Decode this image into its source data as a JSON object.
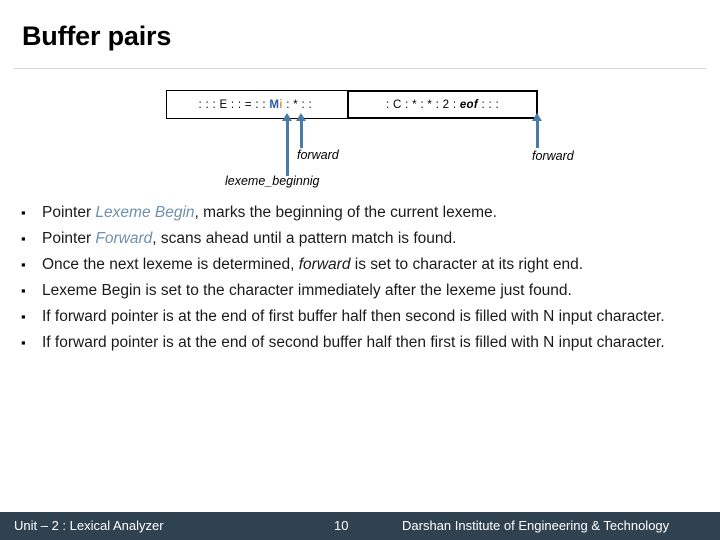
{
  "slide": {
    "title": "Buffer pairs"
  },
  "diagram": {
    "buffer": {
      "left_half": {
        "prefix": ": : : E : : = : : ",
        "char_blue": "M",
        "char_tan": "i",
        "suffix": " : * : : "
      },
      "right_half": {
        "prefix": ": C : * : * : 2 : ",
        "eof": "eof",
        "suffix": " : : :"
      }
    },
    "labels": {
      "forward_left": "forward",
      "forward_right": "forward",
      "lexeme_begin": "lexeme_beginnig"
    },
    "arrow_color": "#4a7ba7"
  },
  "bullets": [
    {
      "marker": "▪",
      "parts": [
        {
          "text": "Pointer ",
          "style": "normal"
        },
        {
          "text": "Lexeme Begin",
          "style": "highlight"
        },
        {
          "text": ", marks the beginning of the current lexeme.",
          "style": "normal"
        }
      ]
    },
    {
      "marker": "▪",
      "parts": [
        {
          "text": "Pointer ",
          "style": "normal"
        },
        {
          "text": "Forward",
          "style": "highlight"
        },
        {
          "text": ", scans ahead until a pattern match is found.",
          "style": "normal"
        }
      ]
    },
    {
      "marker": "▪",
      "parts": [
        {
          "text": "Once the next lexeme is determined, ",
          "style": "normal"
        },
        {
          "text": "forward",
          "style": "italic"
        },
        {
          "text": " is set to character at its right end.",
          "style": "normal"
        }
      ]
    },
    {
      "marker": "▪",
      "parts": [
        {
          "text": "Lexeme Begin is set to the character immediately after the lexeme just found.",
          "style": "normal"
        }
      ]
    },
    {
      "marker": "▪",
      "parts": [
        {
          "text": "If forward pointer is at the end of first buffer half then second is filled with N input character.",
          "style": "normal"
        }
      ]
    },
    {
      "marker": "▪",
      "parts": [
        {
          "text": "If forward pointer is at the end of second buffer half then first is filled with N input character.",
          "style": "normal"
        }
      ]
    }
  ],
  "footer": {
    "left": "Unit – 2 : Lexical Analyzer",
    "page": "10",
    "right": "Darshan Institute of Engineering & Technology",
    "background": "#30414f"
  }
}
